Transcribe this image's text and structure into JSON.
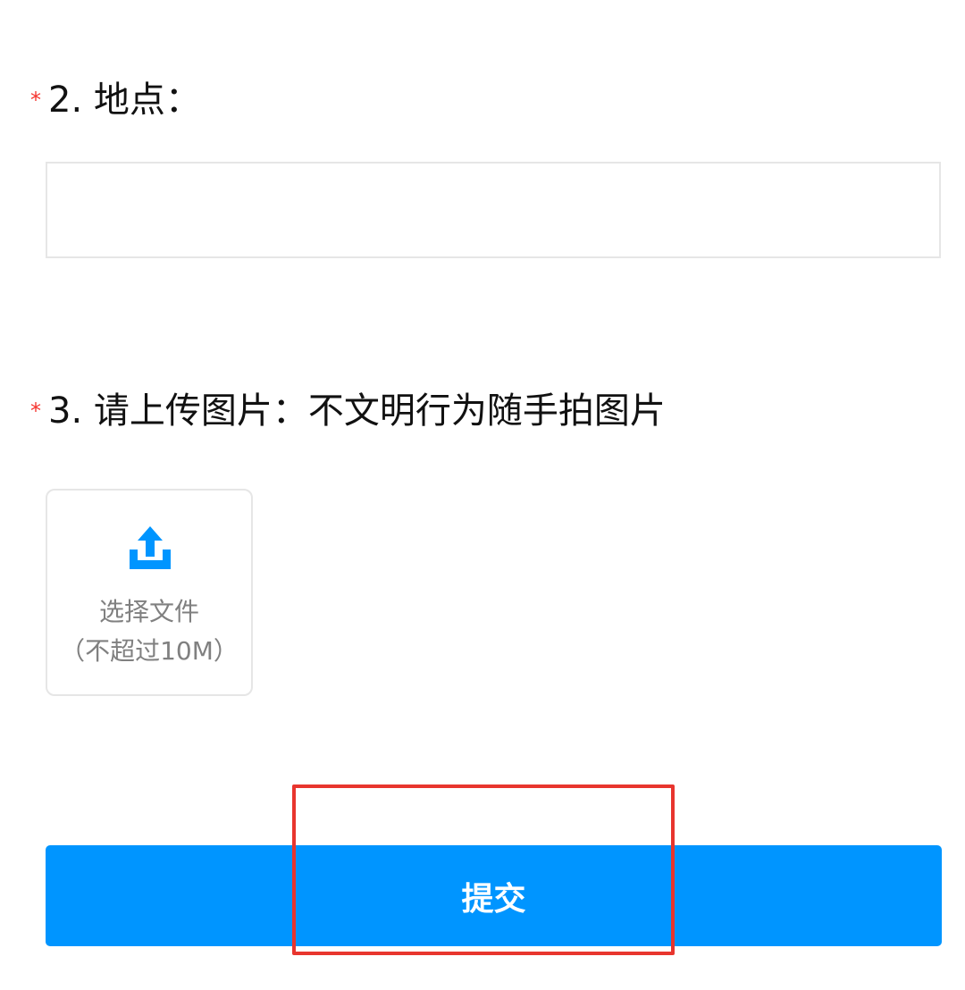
{
  "form": {
    "question2": {
      "required_mark": "*",
      "label": "2. 地点：",
      "input_value": "",
      "input_placeholder": ""
    },
    "question3": {
      "required_mark": "*",
      "label": "3. 请上传图片：不文明行为随手拍图片",
      "upload": {
        "icon": "upload-tray-icon",
        "line1": "选择文件",
        "line2": "（不超过10M）"
      }
    },
    "submit_label": "提交"
  },
  "colors": {
    "required": "#f5342e",
    "primary": "#0095ff",
    "highlight": "#e8352e",
    "muted_text": "#808080",
    "border": "#e6e6e6"
  }
}
